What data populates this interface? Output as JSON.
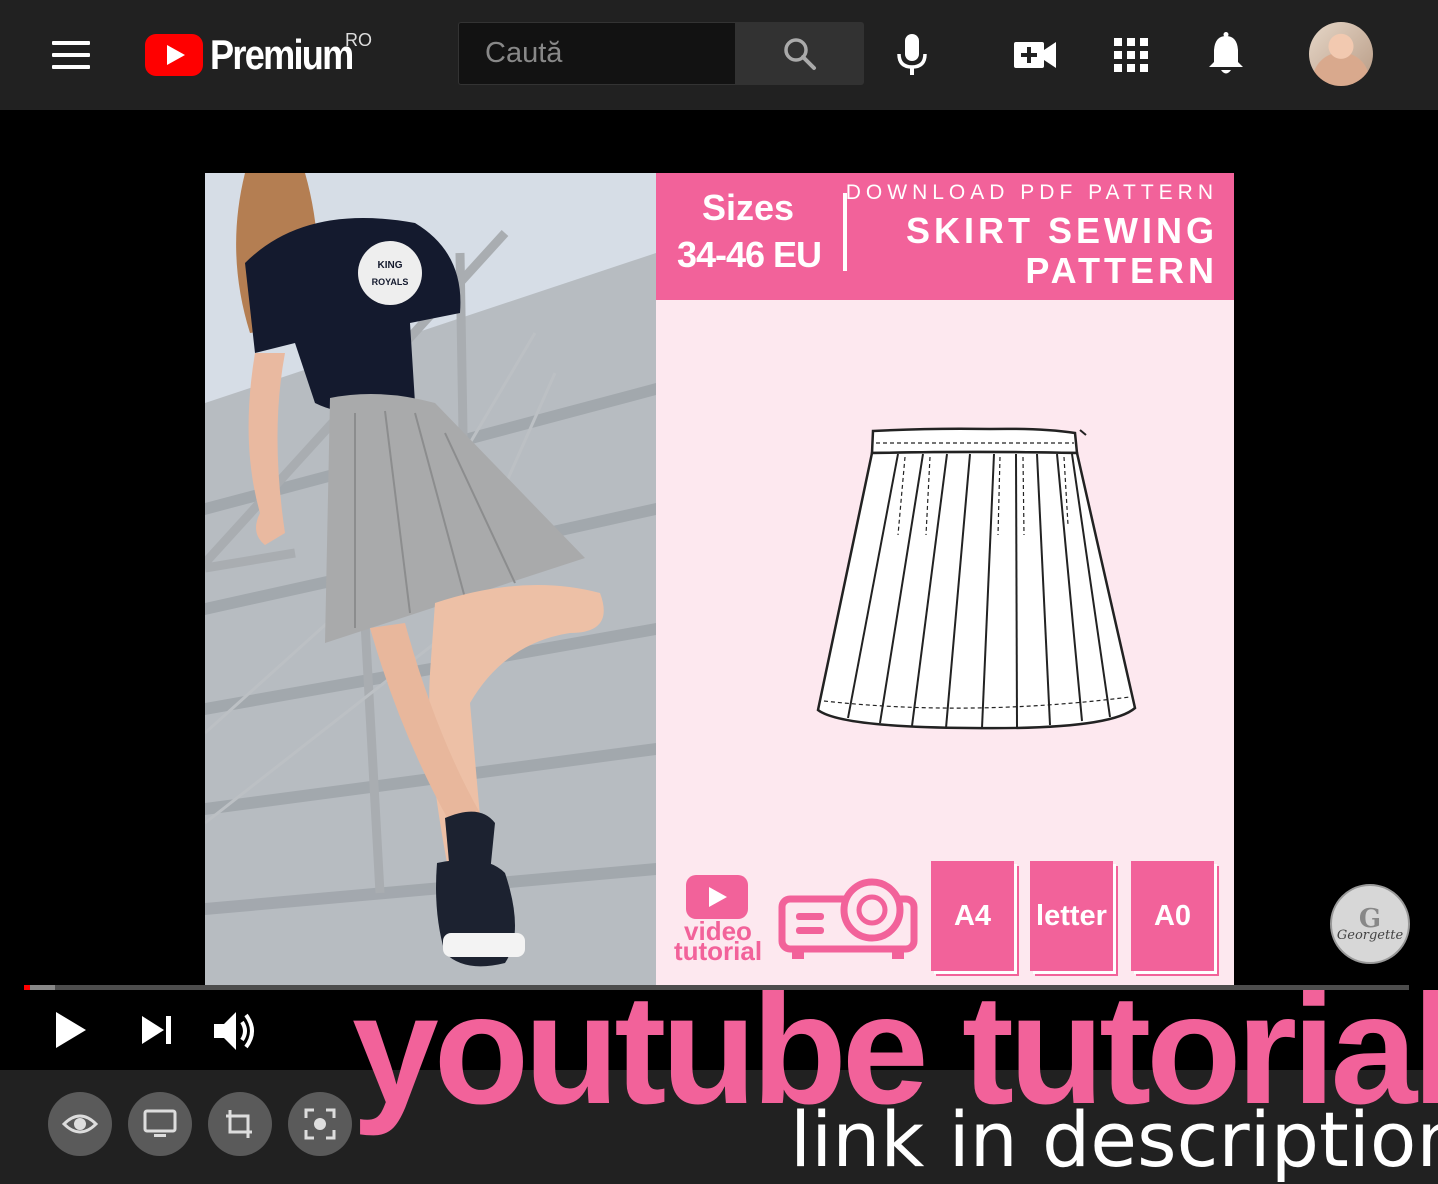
{
  "topbar": {
    "logo_text": "Premium",
    "country_code": "RO",
    "search_placeholder": "Caută"
  },
  "thumbnail": {
    "sizes_label": "Sizes",
    "sizes_range": "34-46 EU",
    "download_label": "DOWNLOAD PDF PATTERN",
    "title_line1": "SKIRT SEWING",
    "title_line2": "PATTERN",
    "video_label_1": "video",
    "video_label_2": "tutorial",
    "formats": [
      "A4",
      "letter",
      "A0"
    ],
    "brand_color": "#f2629a",
    "photo_shirt_text_1": "KING",
    "photo_shirt_text_2": "ROYALS"
  },
  "player": {
    "progress_played": 0.004,
    "progress_buffered": 0.022
  },
  "overlay": {
    "headline": "youtube tutorial",
    "subline": "link in description"
  },
  "channel_watermark": {
    "initial": "G",
    "name": "Georgette"
  },
  "icons": {
    "menu": "hamburger-icon",
    "search": "search-icon",
    "mic": "microphone-icon",
    "create": "create-video-icon",
    "apps": "apps-grid-icon",
    "notifications": "bell-icon",
    "play": "play-icon",
    "next": "next-icon",
    "volume": "volume-icon",
    "bottom_buttons": [
      "eye-icon",
      "monitor-icon",
      "crop-icon",
      "screenshot-icon"
    ]
  }
}
